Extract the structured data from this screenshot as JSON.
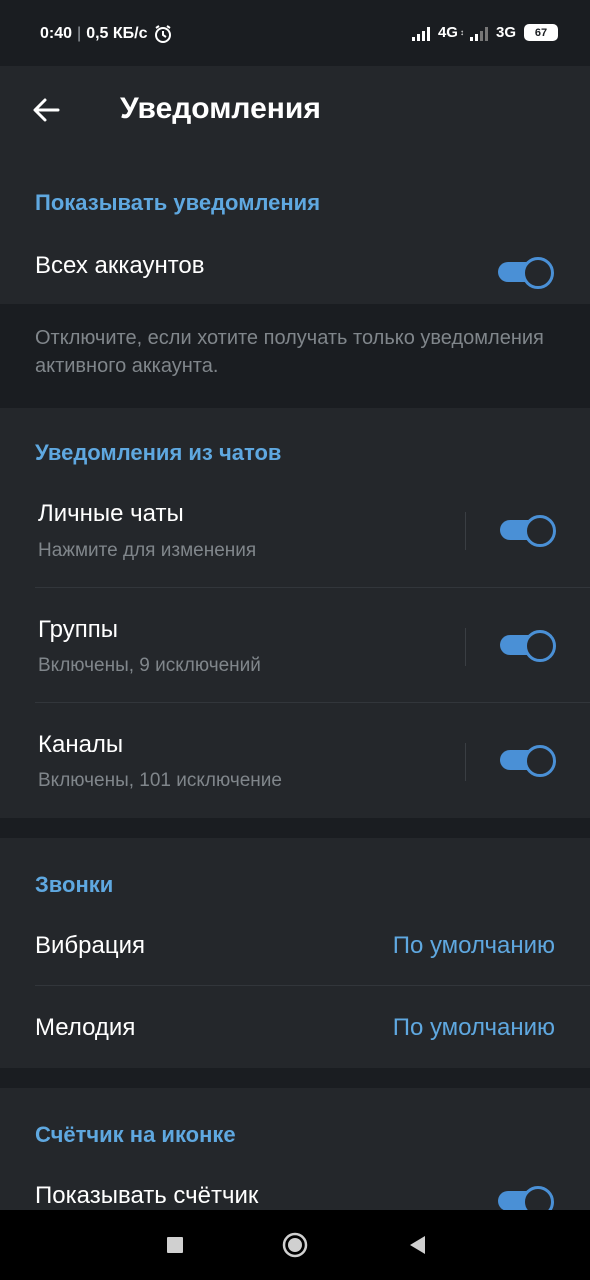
{
  "status_bar": {
    "time": "0:40",
    "speed": "0,5 КБ/с",
    "net1": "4G",
    "net1_sub": "↕",
    "net2": "3G",
    "battery": "67"
  },
  "app_bar": {
    "title": "Уведомления",
    "back_icon": "arrow-back-icon"
  },
  "show_notifications": {
    "header": "Показывать уведомления",
    "all_accounts_label": "Всех аккаунтов",
    "all_accounts_enabled": true,
    "info": "Отключите, если хотите получать только уведомления активного аккаунта."
  },
  "chat_notifications": {
    "header": "Уведомления из чатов",
    "items": [
      {
        "title": "Личные чаты",
        "subtitle": "Нажмите для изменения",
        "enabled": true
      },
      {
        "title": "Группы",
        "subtitle": "Включены, 9 исключений",
        "enabled": true
      },
      {
        "title": "Каналы",
        "subtitle": "Включены, 101 исключение",
        "enabled": true
      }
    ]
  },
  "calls": {
    "header": "Звонки",
    "vibration_label": "Вибрация",
    "vibration_value": "По умолчанию",
    "ringtone_label": "Мелодия",
    "ringtone_value": "По умолчанию"
  },
  "badge_counter": {
    "header": "Счётчик на иконке",
    "show_counter_label": "Показывать счётчик",
    "show_counter_enabled": true
  },
  "nav_bar": {
    "icons": [
      "recents-square-icon",
      "home-circle-icon",
      "back-triangle-icon"
    ]
  },
  "colors": {
    "accent": "#5fa8e0",
    "toggle": "#4a90d6",
    "surface": "#24272b",
    "background": "#1a1d21"
  }
}
